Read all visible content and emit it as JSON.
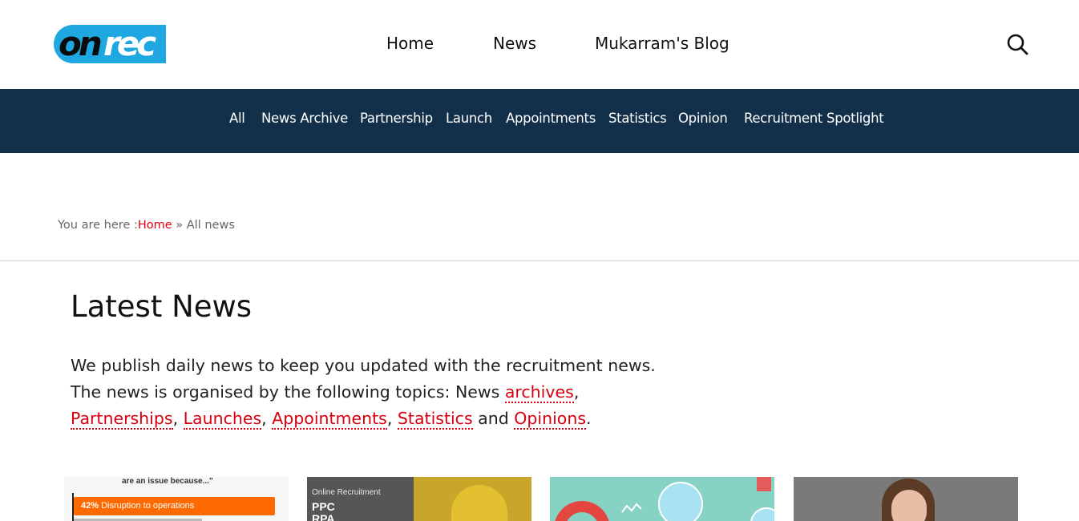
{
  "header": {
    "logo": {
      "on": "on",
      "rec": "rec"
    },
    "nav": [
      {
        "label": "Home"
      },
      {
        "label": "News"
      },
      {
        "label": "Mukarram's Blog"
      }
    ],
    "search_icon": "search-icon"
  },
  "categories": [
    {
      "label": "All"
    },
    {
      "label": "News Archive"
    },
    {
      "label": "Partnership"
    },
    {
      "label": "Launch"
    },
    {
      "label": "Appointments"
    },
    {
      "label": "Statistics"
    },
    {
      "label": "Opinion"
    },
    {
      "label": "Recruitment Spotlight"
    }
  ],
  "breadcrumb": {
    "prefix": "You are here :",
    "home": "Home",
    "separator": " » ",
    "current": "All news"
  },
  "main": {
    "title": "Latest News",
    "intro_line1": "We publish daily news to keep you updated with the recruitment news.",
    "intro_line2_prefix": "The news is organised by the following topics: News ",
    "links": {
      "archives": "archives",
      "partnerships": "Partnerships",
      "launches": "Launches",
      "appointments": "Appointments",
      "statistics": "Statistics",
      "opinions": "Opinions"
    },
    "sep_comma": ",",
    "sep_and": " and ",
    "end_period": "."
  },
  "cards": [
    {
      "quote": "are an issue because...\"",
      "bar_percent": "42%",
      "bar_text": " Disruption to operations"
    },
    {
      "kicker": "Online Recruitment",
      "headline_1": "PPC",
      "headline_2": "RPA"
    },
    {},
    {}
  ],
  "colors": {
    "nav_bar": "#13304a",
    "link_red": "#d7000f",
    "logo_blue": "#1ea7e1"
  }
}
